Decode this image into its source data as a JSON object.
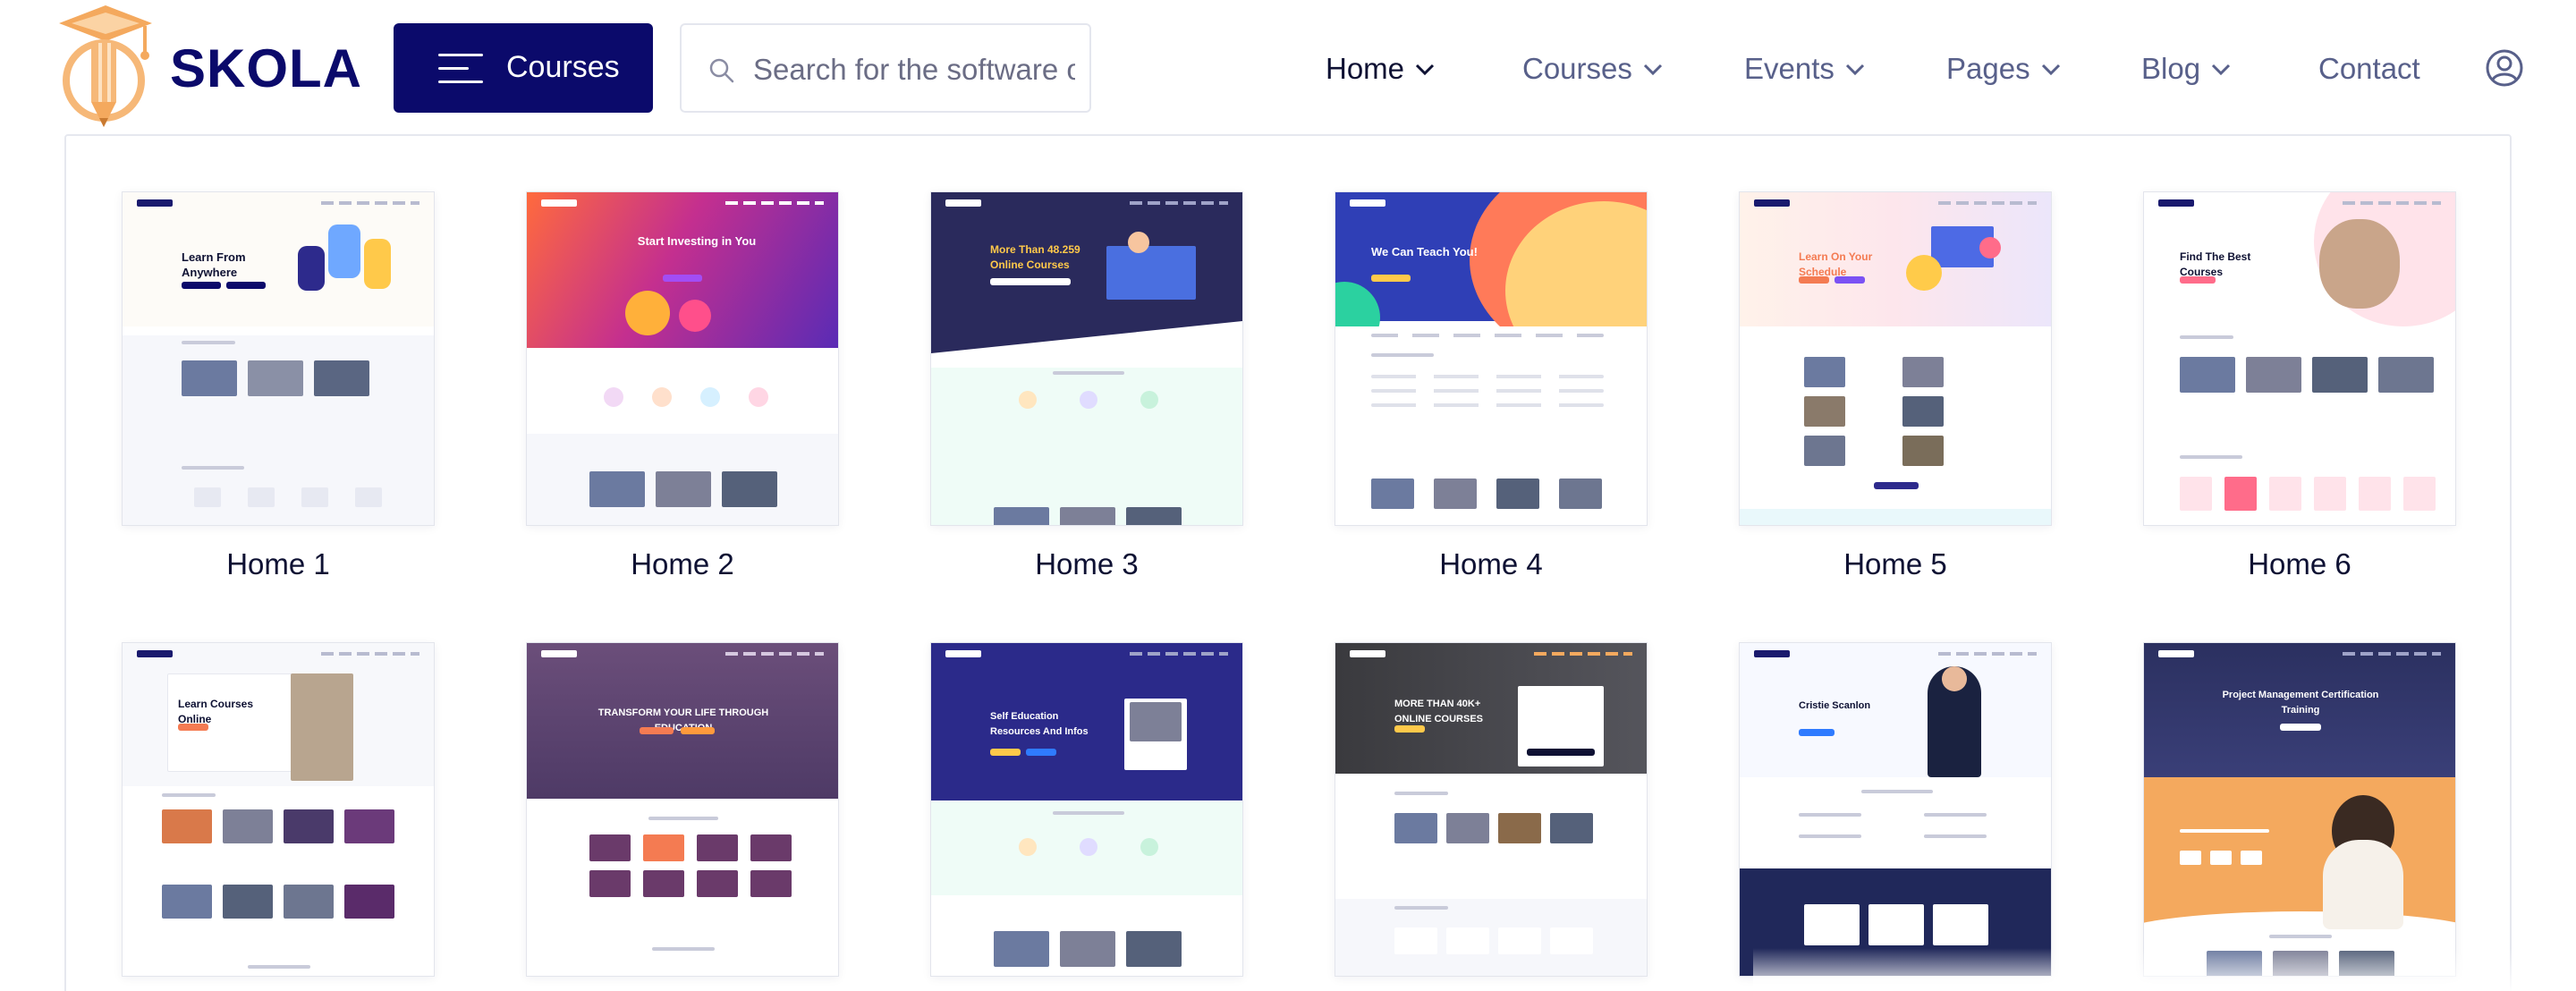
{
  "brand": {
    "name": "SKOLA",
    "logo_colors": {
      "cap": "#f4a95e",
      "pencil": "#f6b878"
    }
  },
  "header": {
    "courses_button": "Courses",
    "search_placeholder": "Search for the software or",
    "nav": [
      {
        "label": "Home",
        "has_dropdown": true,
        "active": true
      },
      {
        "label": "Courses",
        "has_dropdown": true,
        "active": false
      },
      {
        "label": "Events",
        "has_dropdown": true,
        "active": false
      },
      {
        "label": "Pages",
        "has_dropdown": true,
        "active": false
      },
      {
        "label": "Blog",
        "has_dropdown": true,
        "active": false
      },
      {
        "label": "Contact",
        "has_dropdown": false,
        "active": false
      }
    ],
    "user_icon": "user-circle-icon"
  },
  "demos": [
    {
      "title": "Home 1",
      "heading": "Learn From Anywhere"
    },
    {
      "title": "Home 2",
      "heading": "Start Investing in You"
    },
    {
      "title": "Home 3",
      "heading": "More Than 48.259 Online Courses"
    },
    {
      "title": "Home 4",
      "heading": "We Can Teach You!"
    },
    {
      "title": "Home 5",
      "heading": "Learn On Your Schedule"
    },
    {
      "title": "Home 6",
      "heading": "Find The Best Courses"
    },
    {
      "title": "",
      "heading": "Learn Courses Online"
    },
    {
      "title": "",
      "heading": "TRANSFORM YOUR LIFE THROUGH EDUCATION"
    },
    {
      "title": "",
      "heading": "Self Education Resources And Infos"
    },
    {
      "title": "",
      "heading": "MORE THAN 40K+ ONLINE COURSES"
    },
    {
      "title": "",
      "heading": "Cristie Scanlon"
    },
    {
      "title": "",
      "heading": "Project Management Certification Training"
    }
  ],
  "colors": {
    "navy": "#0b0a6b",
    "text_dark": "#0e1133",
    "nav_text": "#58608a",
    "orange": "#f4a95e"
  }
}
